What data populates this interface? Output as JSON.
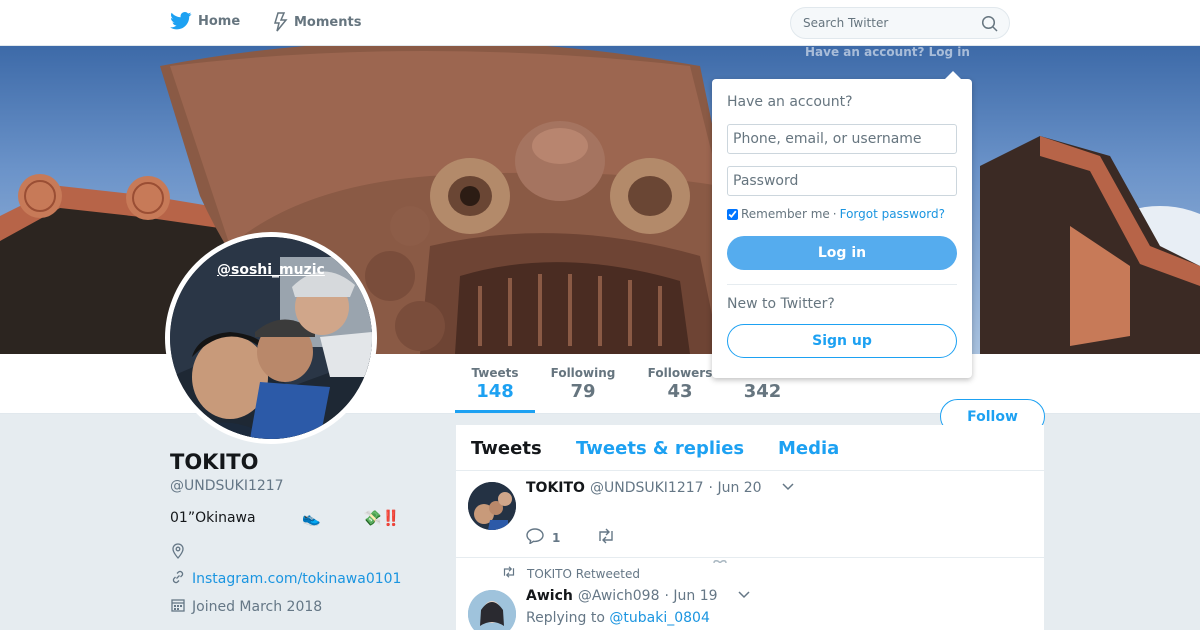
{
  "topnav": {
    "home_label": "Home",
    "moments_label": "Moments",
    "search_placeholder": "Search Twitter"
  },
  "login_hint": "Have an account? Log in",
  "header": {
    "avatar_overlay_text": "@soshi_muzic"
  },
  "stats": {
    "tweets_label": "Tweets",
    "tweets_value": "148",
    "following_label": "Following",
    "following_value": "79",
    "followers_label": "Followers",
    "followers_value": "43",
    "likes_value": "342"
  },
  "follow_label": "Follow",
  "profile": {
    "name": "TOKITO",
    "handle": "@UNDSUKI1217",
    "bio": "01”Okinawa",
    "bio_emoji_1": "👟",
    "bio_emoji_2": "💸‼️",
    "url": "Instagram.com/tokinawa0101",
    "joined": "Joined March 2018"
  },
  "timeline": {
    "tabs": [
      "Tweets",
      "Tweets & replies",
      "Media"
    ],
    "tweets": [
      {
        "name": "TOKITO",
        "user": "@UNDSUKI1217",
        "date": "· Jun 20",
        "reply_count": "1"
      },
      {
        "context": "TOKITO Retweeted",
        "name": "Awich",
        "user": "@Awich098",
        "date": "· Jun 19",
        "reply_prefix": "Replying to",
        "reply_user": "@tubaki_0804"
      }
    ]
  },
  "login_dropdown": {
    "title": "Have an account?",
    "user_placeholder": "Phone, email, or username",
    "pass_placeholder": "Password",
    "remember": "Remember me",
    "separator": "·",
    "forgot": "Forgot password?",
    "login_label": "Log in",
    "new_title": "New to Twitter?",
    "signup_label": "Sign up"
  },
  "colors": {
    "brand": "#1da1f2",
    "login_button": "#55acee"
  }
}
